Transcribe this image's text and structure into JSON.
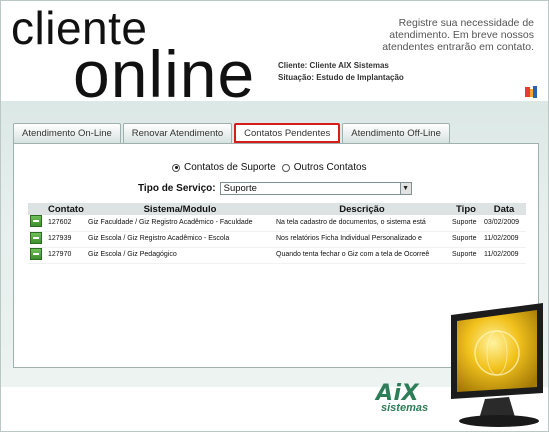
{
  "header": {
    "brand_line1": "cliente",
    "brand_line2": "online",
    "tagline": "Registre sua necessidade de atendimento. Em breve nossos atendentes entrarão em contato.",
    "client_label": "Cliente: Cliente AIX Sistemas",
    "status_label": "Situação: Estudo de Implantação"
  },
  "tabs": [
    {
      "label": "Atendimento On-Line",
      "active": false
    },
    {
      "label": "Renovar Atendimento",
      "active": false
    },
    {
      "label": "Contatos Pendentes",
      "active": true
    },
    {
      "label": "Atendimento Off-Line",
      "active": false
    }
  ],
  "filters": {
    "radio_support": "Contatos de Suporte",
    "radio_other": "Outros Contatos",
    "selected_radio": "Contatos de Suporte",
    "service_label": "Tipo de Serviço:",
    "service_value": "Suporte"
  },
  "table": {
    "headers": [
      "Contato",
      "Sistema/Modulo",
      "Descrição",
      "Tipo",
      "Data"
    ],
    "rows": [
      {
        "contato": "127602",
        "sistema": "Giz Faculdade / Giz Registro Acadêmico - Faculdade",
        "descricao": "Na tela cadastro de documentos, o sistema está",
        "tipo": "Suporte",
        "data": "03/02/2009"
      },
      {
        "contato": "127939",
        "sistema": "Giz Escola / Giz Registro Acadêmico - Escola",
        "descricao": "Nos relatórios Ficha Individual Personalizado e",
        "tipo": "Suporte",
        "data": "11/02/2009"
      },
      {
        "contato": "127970",
        "sistema": "Giz Escola / Giz Pedagógico",
        "descricao": "Quando tenta fechar o Giz com a tela de Ocorreê",
        "tipo": "Suporte",
        "data": "11/02/2009"
      }
    ]
  },
  "footer": {
    "logo_text": "AiX",
    "logo_sub": "sistemas"
  },
  "colors": {
    "active_tab_border": "#d81c1c",
    "band_bg": "#dce8e6",
    "logo_green": "#2d7d58"
  }
}
